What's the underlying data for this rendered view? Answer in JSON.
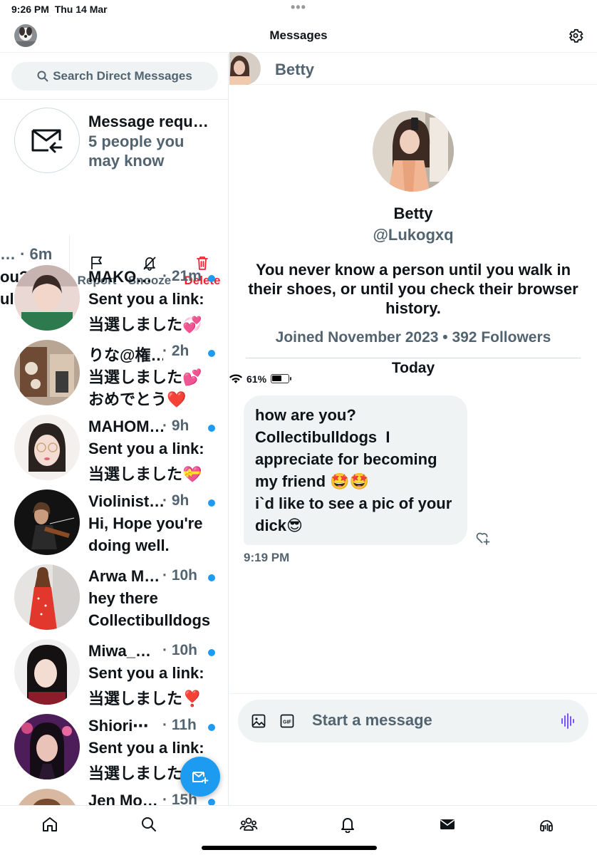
{
  "status_bar": {
    "time": "9:26 PM",
    "date": "Thu 14 Mar",
    "battery": "61%",
    "battery_level": 0.61
  },
  "header": {
    "title": "Messages"
  },
  "search": {
    "placeholder": "Search Direct Messages"
  },
  "requests": {
    "title": "Message requ…",
    "subtitle": "5 people you may know"
  },
  "swiped": {
    "peek_line1": "… · 6m",
    "peek_line2": "ou?",
    "peek_line3": "ulldogs",
    "actions": {
      "report": "Report",
      "snooze": "Snooze",
      "delete": "Delete"
    }
  },
  "conversations": [
    {
      "name": "MAKO…",
      "ago": "· 21m",
      "line1": "Sent you a link:",
      "line2": "当選しました💞",
      "unread": true
    },
    {
      "name": "りな@権…",
      "ago": "· 2h",
      "line1": "当選しました💕",
      "line2": "おめでとう❤️",
      "unread": true
    },
    {
      "name": "MAHOM…",
      "ago": "· 9h",
      "line1": "Sent you a link:",
      "line2": "当選しました💝",
      "unread": true
    },
    {
      "name": "Violinist…",
      "ago": "· 9h",
      "line1": "Hi, Hope you're",
      "line2": "doing well.",
      "unread": true
    },
    {
      "name": "Arwa M…",
      "ago": "· 10h",
      "line1": "hey  there",
      "line2": "Collectibulldogs",
      "unread": true
    },
    {
      "name": "Miwa_…",
      "ago": "· 10h",
      "line1": "Sent you a link:",
      "line2": "当選しました❣️",
      "unread": true
    },
    {
      "name": "Shiori⋯",
      "ago": "· 11h",
      "line1": "Sent you a link:",
      "line2": "当選しました",
      "unread": true
    },
    {
      "name": "Jen Mo…",
      "ago": "· 15h",
      "line1": "",
      "line2": "",
      "unread": true
    }
  ],
  "chat": {
    "header_name": "Betty",
    "profile": {
      "name": "Betty",
      "handle": "@Lukogxq",
      "bio": "You never know a person until you walk in their shoes, or until you check their browser history.",
      "meta": "Joined November 2023 • 392 Followers"
    },
    "day_label": "Today",
    "message_lines": [
      "how are you?",
      "Collectibulldogs  I",
      "appreciate for becoming",
      "my friend 🤩🤩",
      "i`d like to see a pic of your",
      "dick😎"
    ],
    "message_time": "9:19 PM",
    "composer_placeholder": "Start a message"
  },
  "colors": {
    "accent": "#1d9bf0",
    "muted": "#536471",
    "danger": "#f4212e",
    "bubble": "#eff3f4"
  }
}
